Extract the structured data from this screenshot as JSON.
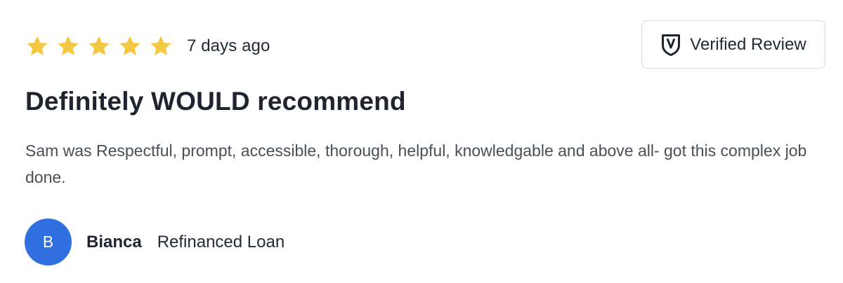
{
  "review": {
    "rating": 5,
    "rating_max": 5,
    "time_ago": "7 days ago",
    "verified_label": "Verified Review",
    "title": "Definitely WOULD recommend",
    "body": "Sam was Respectful, prompt, accessible, thorough, helpful, knowledgable and above all- got this complex job done.",
    "author": {
      "initial": "B",
      "name": "Bianca",
      "loan_type": "Refinanced Loan"
    }
  },
  "icons": {
    "star": "star-icon",
    "verified": "shield-check-icon"
  },
  "colors": {
    "star": "#F5C842",
    "avatar": "#2F6FE0",
    "title": "#1F2430",
    "body": "#4A4F57",
    "border": "#D6D9DE"
  }
}
